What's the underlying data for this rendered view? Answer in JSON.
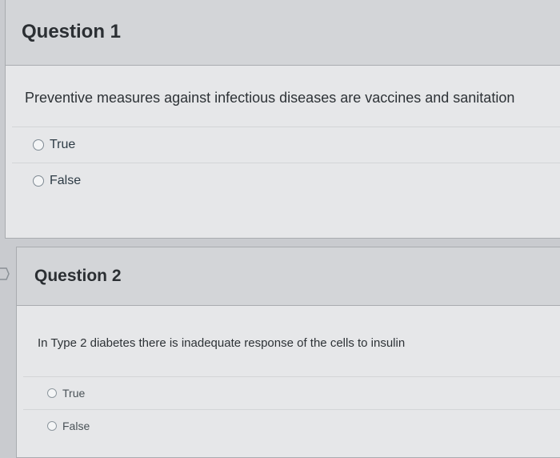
{
  "questions": [
    {
      "title": "Question 1",
      "text": "Preventive measures against infectious diseases are vaccines and sanitation",
      "options": [
        "True",
        "False"
      ]
    },
    {
      "title": "Question 2",
      "text": "In Type 2 diabetes there is inadequate response of the cells to insulin",
      "options": [
        "True",
        "False"
      ]
    }
  ],
  "icons": {
    "flag": "bookmark-flag-icon"
  },
  "colors": {
    "panel": "#e6e7e9",
    "header": "#d3d5d8",
    "border": "#a9acb0"
  }
}
